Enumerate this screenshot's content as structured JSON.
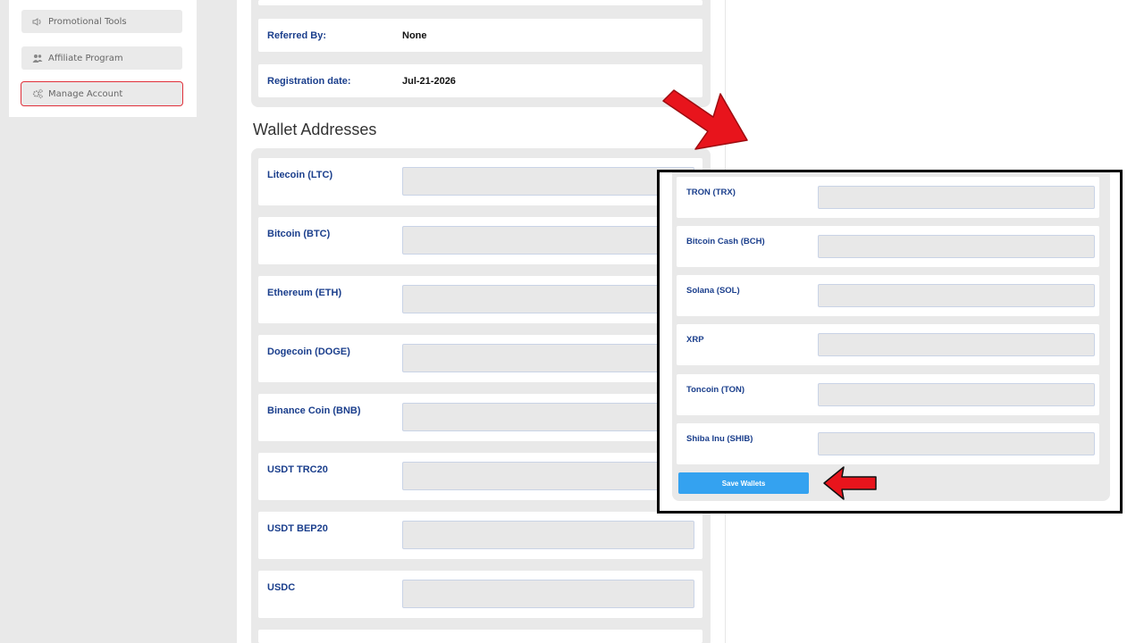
{
  "sidebar": {
    "items": [
      {
        "label": "Promotional Tools",
        "icon": "megaphone-icon"
      },
      {
        "label": "Affiliate Program",
        "icon": "users-icon"
      },
      {
        "label": "Manage Account",
        "icon": "cogs-icon",
        "active": true
      }
    ]
  },
  "account_info": {
    "referred_by_label": "Referred By:",
    "referred_by_value": "None",
    "registration_label": "Registration date:",
    "registration_value": "Jul-21-2026"
  },
  "wallets": {
    "section_title": "Wallet Addresses",
    "items": [
      {
        "label": "Litecoin (LTC)",
        "value": ""
      },
      {
        "label": "Bitcoin (BTC)",
        "value": ""
      },
      {
        "label": "Ethereum (ETH)",
        "value": ""
      },
      {
        "label": "Dogecoin (DOGE)",
        "value": ""
      },
      {
        "label": "Binance Coin (BNB)",
        "value": ""
      },
      {
        "label": "USDT TRC20",
        "value": ""
      },
      {
        "label": "USDT BEP20",
        "value": ""
      },
      {
        "label": "USDC",
        "value": ""
      }
    ]
  },
  "zoom": {
    "items": [
      {
        "label": "TRON (TRX)",
        "value": ""
      },
      {
        "label": "Bitcoin Cash (BCH)",
        "value": ""
      },
      {
        "label": "Solana (SOL)",
        "value": ""
      },
      {
        "label": "XRP",
        "value": ""
      },
      {
        "label": "Toncoin (TON)",
        "value": ""
      },
      {
        "label": "Shiba Inu (SHIB)",
        "value": ""
      }
    ],
    "save_label": "Save Wallets"
  },
  "colors": {
    "label_blue": "#1a3e8c",
    "save_button": "#34a2f0",
    "highlight_red": "#e0303a",
    "arrow_red": "#e8141c"
  }
}
